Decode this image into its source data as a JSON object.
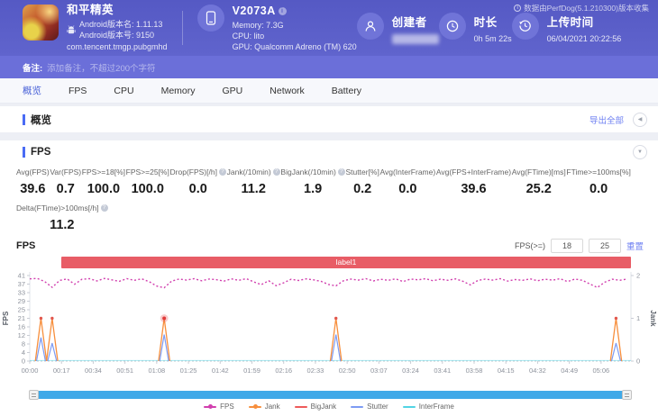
{
  "header": {
    "app": {
      "title": "和平精英",
      "version_name": "Android版本名: 1.11.13",
      "version_code": "Android版本号: 9150",
      "package": "com.tencent.tmgp.pubgmhd"
    },
    "device": {
      "name": "V2073A",
      "memory": "Memory: 7.3G",
      "cpu": "CPU: lito",
      "gpu": "GPU: Qualcomm Adreno (TM) 620"
    },
    "creator": {
      "label": "创建者"
    },
    "duration": {
      "label": "时长",
      "value": "0h 5m 22s"
    },
    "upload": {
      "label": "上传时间",
      "value": "06/04/2021 20:22:56"
    },
    "collector_note": "数据由PerfDog(5.1.210300)版本收集"
  },
  "note_bar": {
    "label": "备注:",
    "placeholder": "添加备注，不超过200个字符"
  },
  "tabs": [
    {
      "label": "概览",
      "active": true
    },
    {
      "label": "FPS",
      "active": false
    },
    {
      "label": "CPU",
      "active": false
    },
    {
      "label": "Memory",
      "active": false
    },
    {
      "label": "GPU",
      "active": false
    },
    {
      "label": "Network",
      "active": false
    },
    {
      "label": "Battery",
      "active": false
    }
  ],
  "overview_section": {
    "title": "概览",
    "export_label": "导出全部"
  },
  "fps_section": {
    "title": "FPS",
    "stats": [
      {
        "label": "Avg(FPS)",
        "value": "39.6"
      },
      {
        "label": "Var(FPS)",
        "value": "0.7"
      },
      {
        "label": "FPS>=18[%]",
        "value": "100.0"
      },
      {
        "label": "FPS>=25[%]",
        "value": "100.0"
      },
      {
        "label": "Drop(FPS)[/h]",
        "value": "0.0"
      },
      {
        "label": "Jank(/10min)",
        "value": "11.2"
      },
      {
        "label": "BigJank(/10min)",
        "value": "1.9"
      },
      {
        "label": "Stutter[%]",
        "value": "0.2"
      },
      {
        "label": "Avg(InterFrame)",
        "value": "0.0"
      },
      {
        "label": "Avg(FPS+InterFrame)",
        "value": "39.6"
      },
      {
        "label": "Avg(FTime)[ms]",
        "value": "25.2"
      },
      {
        "label": "FTime>=100ms[%]",
        "value": "0.0"
      }
    ],
    "stats_row2": {
      "label": "Delta(FTime)>100ms[/h]",
      "value": "11.2"
    },
    "chart_title": "FPS",
    "threshold": {
      "label": "FPS(>=)",
      "input1": "18",
      "input2": "25",
      "reset_label": "重置"
    },
    "label_bar": "label1"
  },
  "chart_data": {
    "type": "line",
    "title": "FPS",
    "ylabel_left": "FPS",
    "ylabel_right": "Jank",
    "y_left_ticks": [
      41,
      37,
      33,
      29,
      25,
      21,
      16,
      12,
      8,
      4,
      0
    ],
    "y_left_max": 41.3,
    "y_right_ticks": [
      2,
      1,
      0
    ],
    "y_right_max": 2,
    "x_ticks": [
      "00:00",
      "00:17",
      "00:34",
      "00:51",
      "01:08",
      "01:25",
      "01:42",
      "01:59",
      "02:16",
      "02:33",
      "02:50",
      "03:07",
      "03:24",
      "03:41",
      "03:58",
      "04:15",
      "04:32",
      "04:49",
      "05:06"
    ],
    "x_tick_interval": 17,
    "x_range_seconds": [
      0,
      322
    ],
    "grid": false,
    "legend_position": "bottom",
    "series": [
      {
        "name": "FPS",
        "color": "#d13fae",
        "axis": "left",
        "x": [
          0,
          4,
          8,
          12,
          16,
          20,
          24,
          28,
          32,
          36,
          40,
          44,
          48,
          52,
          56,
          60,
          64,
          68,
          72,
          76,
          80,
          84,
          88,
          92,
          96,
          100,
          104,
          108,
          112,
          116,
          120,
          124,
          128,
          132,
          136,
          140,
          144,
          148,
          152,
          156,
          160,
          164,
          168,
          172,
          176,
          180,
          184,
          188,
          192,
          196,
          200,
          204,
          208,
          212,
          216,
          220,
          224,
          228,
          232,
          236,
          240,
          244,
          248,
          252,
          256,
          260,
          264,
          268,
          272,
          276,
          280,
          284,
          288,
          292,
          296,
          300,
          304,
          308,
          312,
          316,
          320
        ],
        "y": [
          39.7,
          39.9,
          38.4,
          35.6,
          38.9,
          39.7,
          37.1,
          39.5,
          39.8,
          38.7,
          39.9,
          39.2,
          38.5,
          39.8,
          39.0,
          39.7,
          38.3,
          36.2,
          35.4,
          38.6,
          39.6,
          39.1,
          39.8,
          38.8,
          39.6,
          39.3,
          38.6,
          39.7,
          39.0,
          39.8,
          38.2,
          36.9,
          38.8,
          36.4,
          37.8,
          39.5,
          38.9,
          39.7,
          39.2,
          38.5,
          37.0,
          36.3,
          38.8,
          39.6,
          39.1,
          39.8,
          38.7,
          39.5,
          39.0,
          39.7,
          38.4,
          39.6,
          39.2,
          39.8,
          38.8,
          39.5,
          39.0,
          39.7,
          38.5,
          36.8,
          38.9,
          39.6,
          39.1,
          39.8,
          38.6,
          39.4,
          39.0,
          39.7,
          38.8,
          39.5,
          39.1,
          39.8,
          38.4,
          39.6,
          39.0,
          37.2,
          35.5,
          38.1,
          39.5,
          39.0,
          39.6
        ]
      },
      {
        "name": "Jank",
        "color": "#f78f3d",
        "axis": "right",
        "spikes": [
          {
            "t": 6,
            "v": 1
          },
          {
            "t": 12,
            "v": 1
          },
          {
            "t": 72,
            "v": 1
          },
          {
            "t": 164,
            "v": 1
          },
          {
            "t": 314,
            "v": 1
          }
        ]
      },
      {
        "name": "BigJank",
        "color": "#ee5a5a",
        "axis": "right",
        "spikes": [
          {
            "t": 72,
            "v": 1
          }
        ]
      },
      {
        "name": "Stutter",
        "color": "#7d9bf3",
        "axis": "right",
        "spikes": [
          {
            "t": 6,
            "v": 0.55
          },
          {
            "t": 12,
            "v": 0.42
          },
          {
            "t": 72,
            "v": 0.62
          },
          {
            "t": 164,
            "v": 0.62
          },
          {
            "t": 314,
            "v": 0.42
          }
        ]
      },
      {
        "name": "InterFrame",
        "color": "#52d4e4",
        "axis": "right",
        "spikes": []
      }
    ]
  }
}
